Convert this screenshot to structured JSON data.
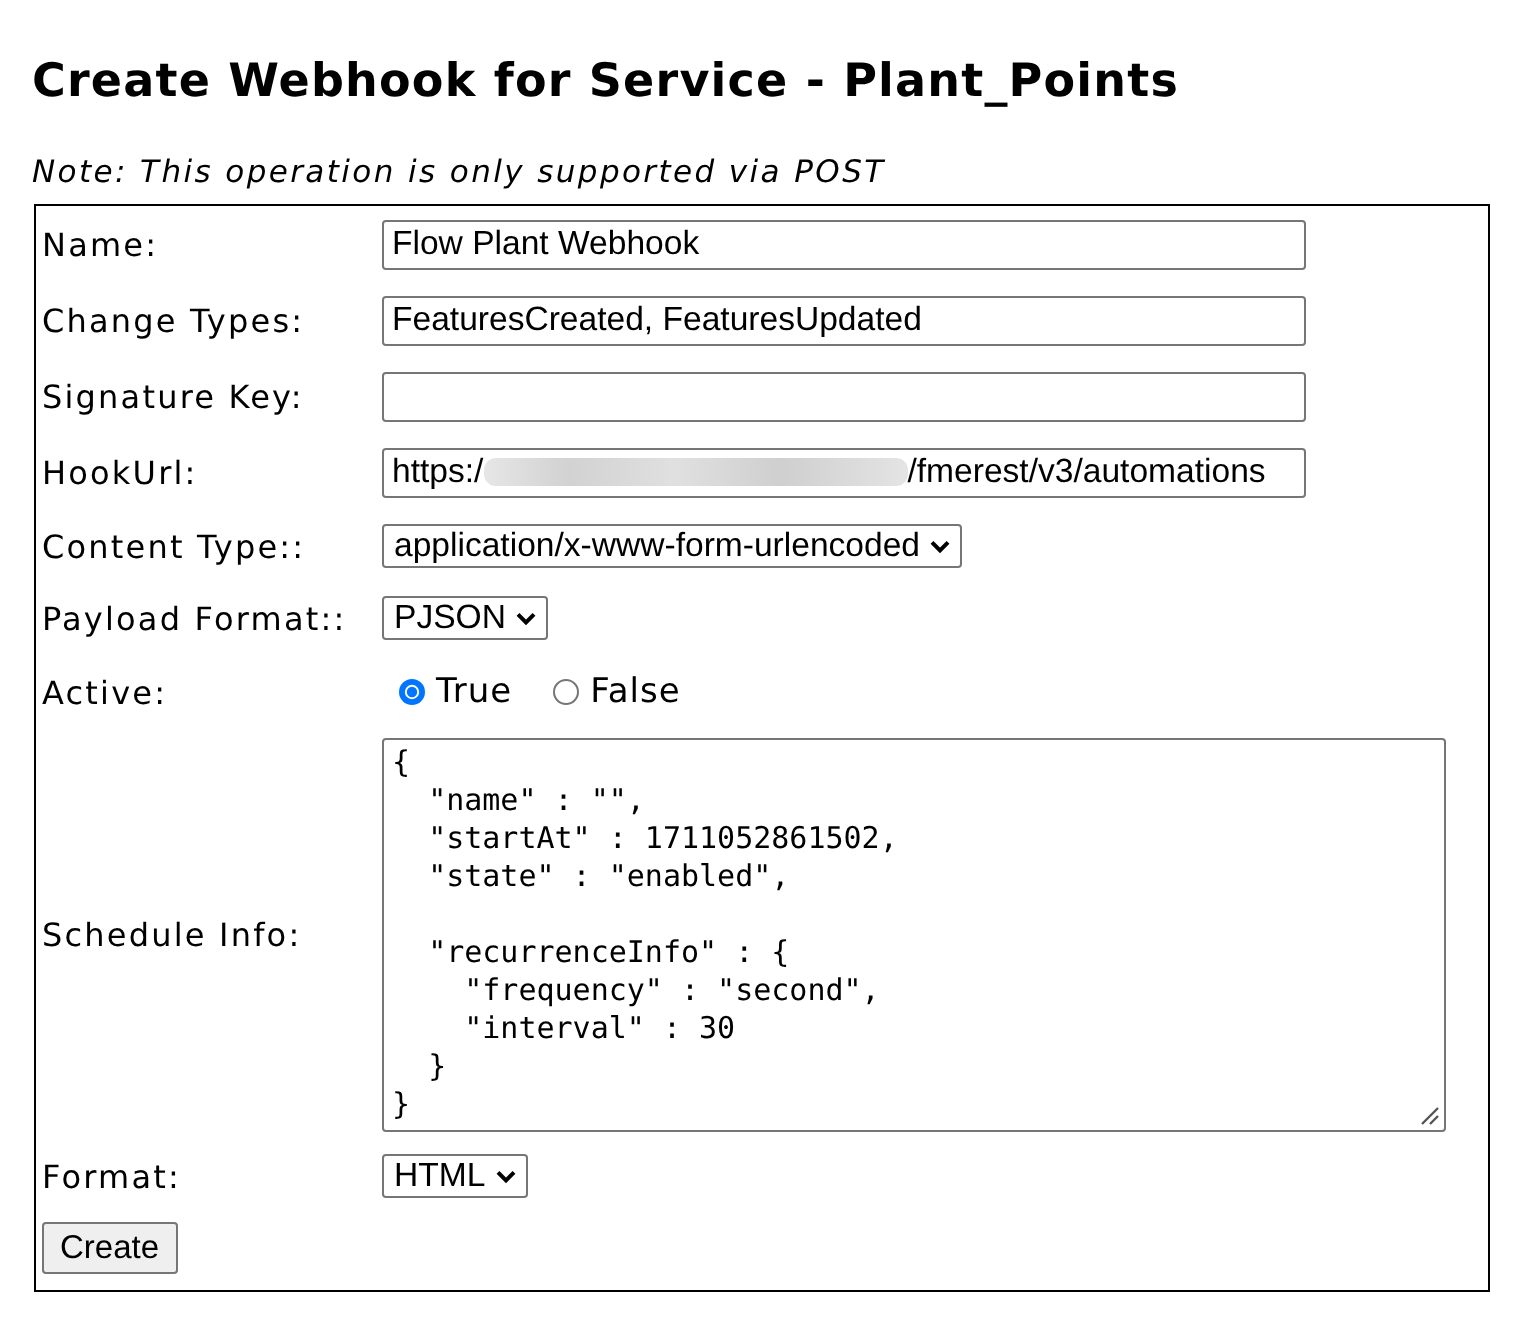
{
  "title": "Create Webhook for Service - Plant_Points",
  "note": "Note: This operation is only supported via POST",
  "form": {
    "fields": [
      {
        "kind": "text",
        "label": "Name:",
        "value": "Flow Plant Webhook"
      },
      {
        "kind": "text",
        "label": "Change Types:",
        "value": "FeaturesCreated, FeaturesUpdated"
      },
      {
        "kind": "text",
        "label": "Signature Key:"
      },
      {
        "kind": "redacted",
        "label": "HookUrl:",
        "value_before": "https:/",
        "value_after": "/fmerest/v3/automations"
      },
      {
        "kind": "select",
        "label": "Content Type::",
        "value": "application/x-www-form-urlencoded"
      },
      {
        "kind": "select",
        "label": "Payload Format::",
        "value": "PJSON"
      },
      {
        "kind": "radio",
        "label": "Active:",
        "options": [
          {
            "label": "True",
            "selected": true
          },
          {
            "label": "False",
            "selected": false
          }
        ]
      },
      {
        "kind": "textarea",
        "label": "Schedule Info:",
        "value": "{\n  \"name\" : \"\",\n  \"startAt\" : 1711052861502,\n  \"state\" : \"enabled\",\n\n  \"recurrenceInfo\" : {\n    \"frequency\" : \"second\",\n    \"interval\" : 30\n  }\n}"
      },
      {
        "kind": "select",
        "label": "Format:",
        "value": "HTML"
      }
    ],
    "submit_button": "Create"
  }
}
